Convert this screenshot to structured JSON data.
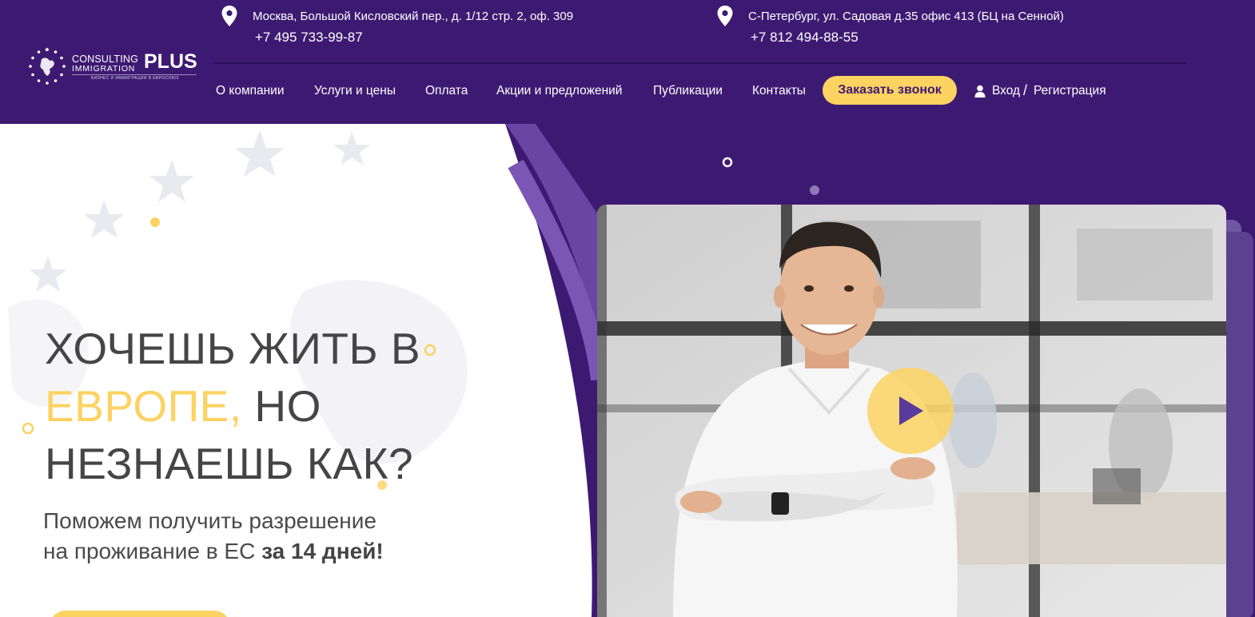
{
  "logo": {
    "line1": "CONSULTING",
    "line2": "IMMIGRATION",
    "plus": "PLUS",
    "tagline": "БИЗНЕС И ИММИГРАЦИЯ В ЕВРОСОЮЗ"
  },
  "offices": [
    {
      "address": "Москва, Большой Кисловский пер., д. 1/12 стр. 2, оф. 309",
      "phone": "+7 495 733-99-87",
      "icon": "map-pin-icon"
    },
    {
      "address": "С-Петербург, ул. Садовая д.35 офис 413 (БЦ на Сенной)",
      "phone": "+7 812 494-88-55",
      "icon": "map-pin-icon"
    }
  ],
  "nav": [
    {
      "label": "О компании"
    },
    {
      "label": "Услуги и цены"
    },
    {
      "label": "Оплата"
    },
    {
      "label": "Акции и предложений"
    },
    {
      "label": "Публикации"
    },
    {
      "label": "Контакты"
    }
  ],
  "call_button": "Заказать звонок",
  "auth": {
    "login": "Вход",
    "separator": "/",
    "register": "Регистрация",
    "icon": "user-icon"
  },
  "hero": {
    "headline_line1": "ХОЧЕШЬ ЖИТЬ В",
    "headline_highlight": "ЕВРОПЕ,",
    "headline_line2_rest": " НО",
    "headline_line3": "НЕЗНАЕШЬ КАК?",
    "sub_line1": "Поможем получить разрешение",
    "sub_line2": "на проживание в ЕС ",
    "sub_bold": "за 14 дней!",
    "play_icon": "play-icon"
  },
  "colors": {
    "brand_purple": "#3d1a72",
    "accent_yellow": "#fcd261",
    "text_dark": "#454545"
  }
}
